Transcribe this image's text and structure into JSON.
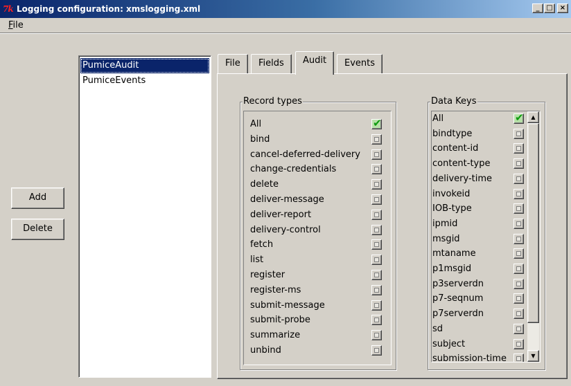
{
  "window": {
    "title": "Logging configuration: xmslogging.xml",
    "icon": "7k",
    "minimize_glyph": "_",
    "maximize_glyph": "□",
    "close_glyph": "×"
  },
  "menu": {
    "file_first": "F",
    "file_rest": "ile"
  },
  "buttons": {
    "add": "Add",
    "delete": "Delete"
  },
  "list": {
    "items": [
      "PumiceAudit",
      "PumiceEvents"
    ],
    "selected": "PumiceAudit"
  },
  "tabs": [
    {
      "label": "File",
      "active": false
    },
    {
      "label": "Fields",
      "active": false
    },
    {
      "label": "Audit",
      "active": true
    },
    {
      "label": "Events",
      "active": false
    }
  ],
  "record_types": {
    "legend": "Record types",
    "items": [
      {
        "label": "All",
        "checked": true
      },
      {
        "label": "bind",
        "checked": false
      },
      {
        "label": "cancel-deferred-delivery",
        "checked": false
      },
      {
        "label": "change-credentials",
        "checked": false
      },
      {
        "label": "delete",
        "checked": false
      },
      {
        "label": "deliver-message",
        "checked": false
      },
      {
        "label": "deliver-report",
        "checked": false
      },
      {
        "label": "delivery-control",
        "checked": false
      },
      {
        "label": "fetch",
        "checked": false
      },
      {
        "label": "list",
        "checked": false
      },
      {
        "label": "register",
        "checked": false
      },
      {
        "label": "register-ms",
        "checked": false
      },
      {
        "label": "submit-message",
        "checked": false
      },
      {
        "label": "submit-probe",
        "checked": false
      },
      {
        "label": "summarize",
        "checked": false
      },
      {
        "label": "unbind",
        "checked": false
      }
    ]
  },
  "data_keys": {
    "legend": "Data Keys",
    "items": [
      {
        "label": "All",
        "checked": true
      },
      {
        "label": "bindtype",
        "checked": false
      },
      {
        "label": "content-id",
        "checked": false
      },
      {
        "label": "content-type",
        "checked": false
      },
      {
        "label": "delivery-time",
        "checked": false
      },
      {
        "label": "invokeid",
        "checked": false
      },
      {
        "label": "IOB-type",
        "checked": false
      },
      {
        "label": "ipmid",
        "checked": false
      },
      {
        "label": "msgid",
        "checked": false
      },
      {
        "label": "mtaname",
        "checked": false
      },
      {
        "label": "p1msgid",
        "checked": false
      },
      {
        "label": "p3serverdn",
        "checked": false
      },
      {
        "label": "p7-seqnum",
        "checked": false
      },
      {
        "label": "p7serverdn",
        "checked": false
      },
      {
        "label": "sd",
        "checked": false
      },
      {
        "label": "subject",
        "checked": false
      },
      {
        "label": "submission-time",
        "checked": false
      }
    ],
    "scroll_position": 0.0,
    "scroll_visible_fraction": 0.88
  },
  "colors": {
    "selection": "#0a246a",
    "check_green": "#0d9a0d",
    "face": "#d4d0c8"
  }
}
